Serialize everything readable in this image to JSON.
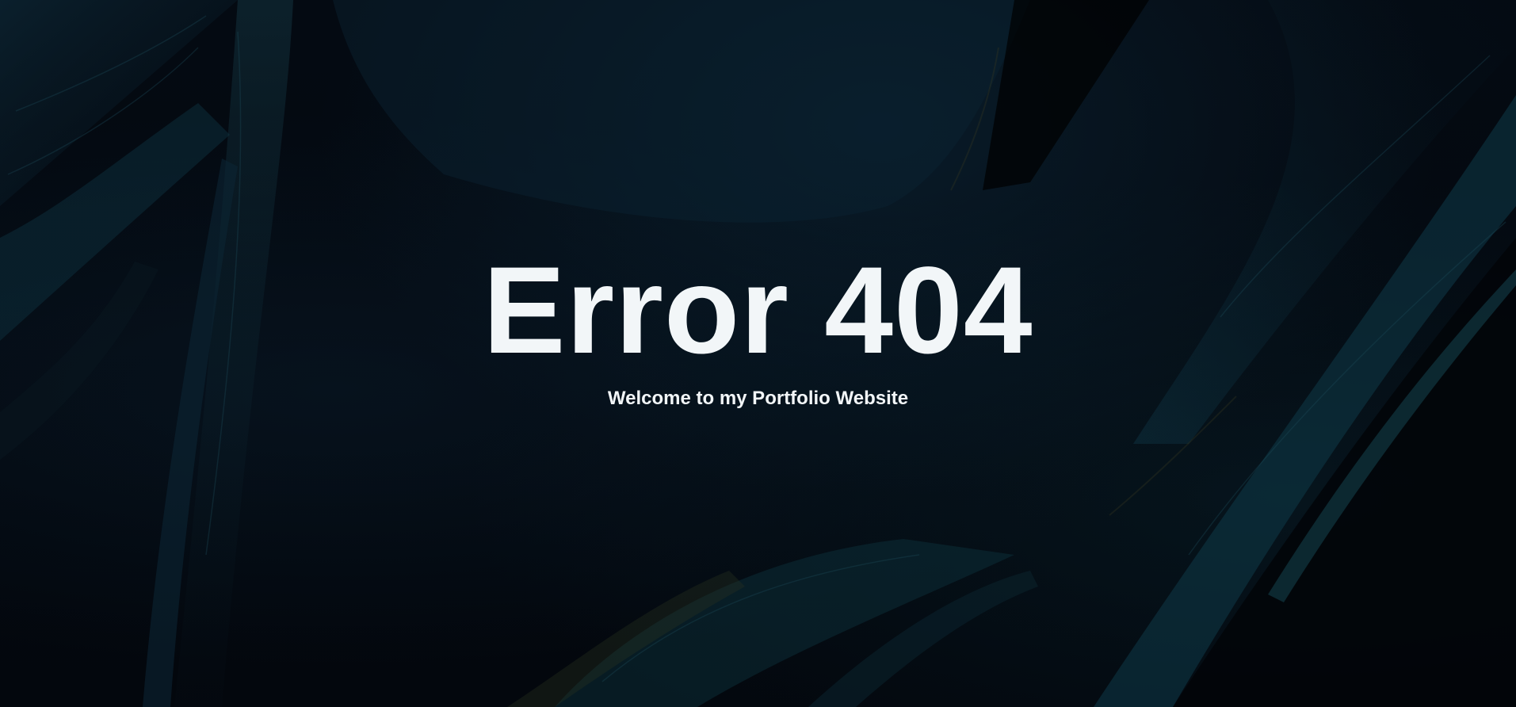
{
  "background": {
    "description_icon": "abstract-brush-strokes-background",
    "base_color": "#03080f",
    "accent_color": "#0f3a4a",
    "highlight_color": "#2a3a2a"
  },
  "hero": {
    "title": "Error 404",
    "subtitle": "Welcome to my Portfolio Website",
    "text_color": "#f2f6f8"
  }
}
